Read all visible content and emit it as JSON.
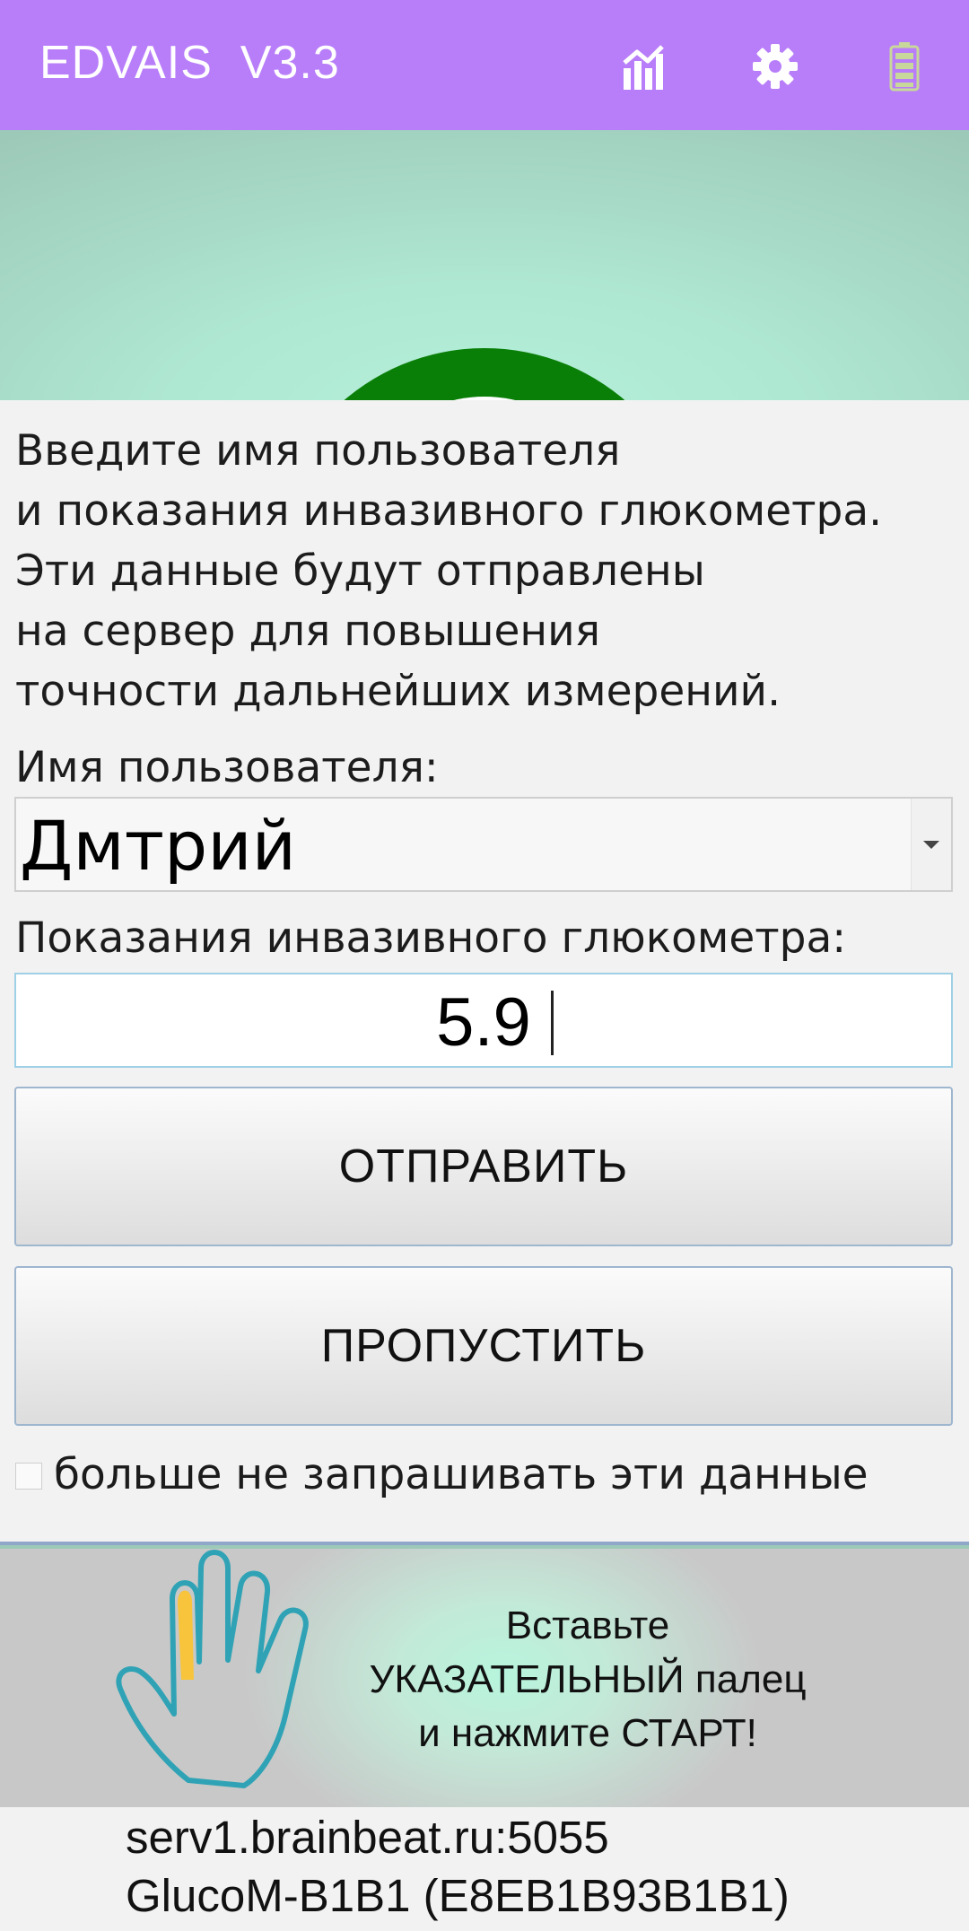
{
  "app_bar": {
    "title": "EDVAIS  V3.3",
    "background_color": "#b87ef9",
    "icons": [
      "chart-icon",
      "gear-icon",
      "battery-icon"
    ],
    "battery_color": "#c8d79a"
  },
  "gauge": {
    "color": "#0a7f07"
  },
  "dialog": {
    "intro_lines": [
      "Введите имя пользователя",
      "и показания инвазивного глюкометра.",
      "Эти данные будут отправлены",
      "на сервер для повышения",
      "точности дальнейших измерений."
    ],
    "username_label": "Имя пользователя:",
    "username_value": "Дмтрий",
    "glucose_label": "Показания инвазивного глюкометра:",
    "glucose_value": "5.9",
    "send_label": "ОТПРАВИТЬ",
    "skip_label": "ПРОПУСТИТЬ",
    "dont_ask_label": "больше не запрашивать эти данные",
    "dont_ask_checked": false
  },
  "banner": {
    "instruction_lines": [
      "Вставьте",
      "УКАЗАТЕЛЬНЫЙ палец",
      "и нажмите СТАРТ!"
    ],
    "hand_outline_color": "#2fa3b5",
    "highlight_finger_color": "#f7c43b"
  },
  "footer": {
    "server": "serv1.brainbeat.ru:5055",
    "device": "GlucoM-B1B1 (E8EB1B93B1B1)"
  }
}
